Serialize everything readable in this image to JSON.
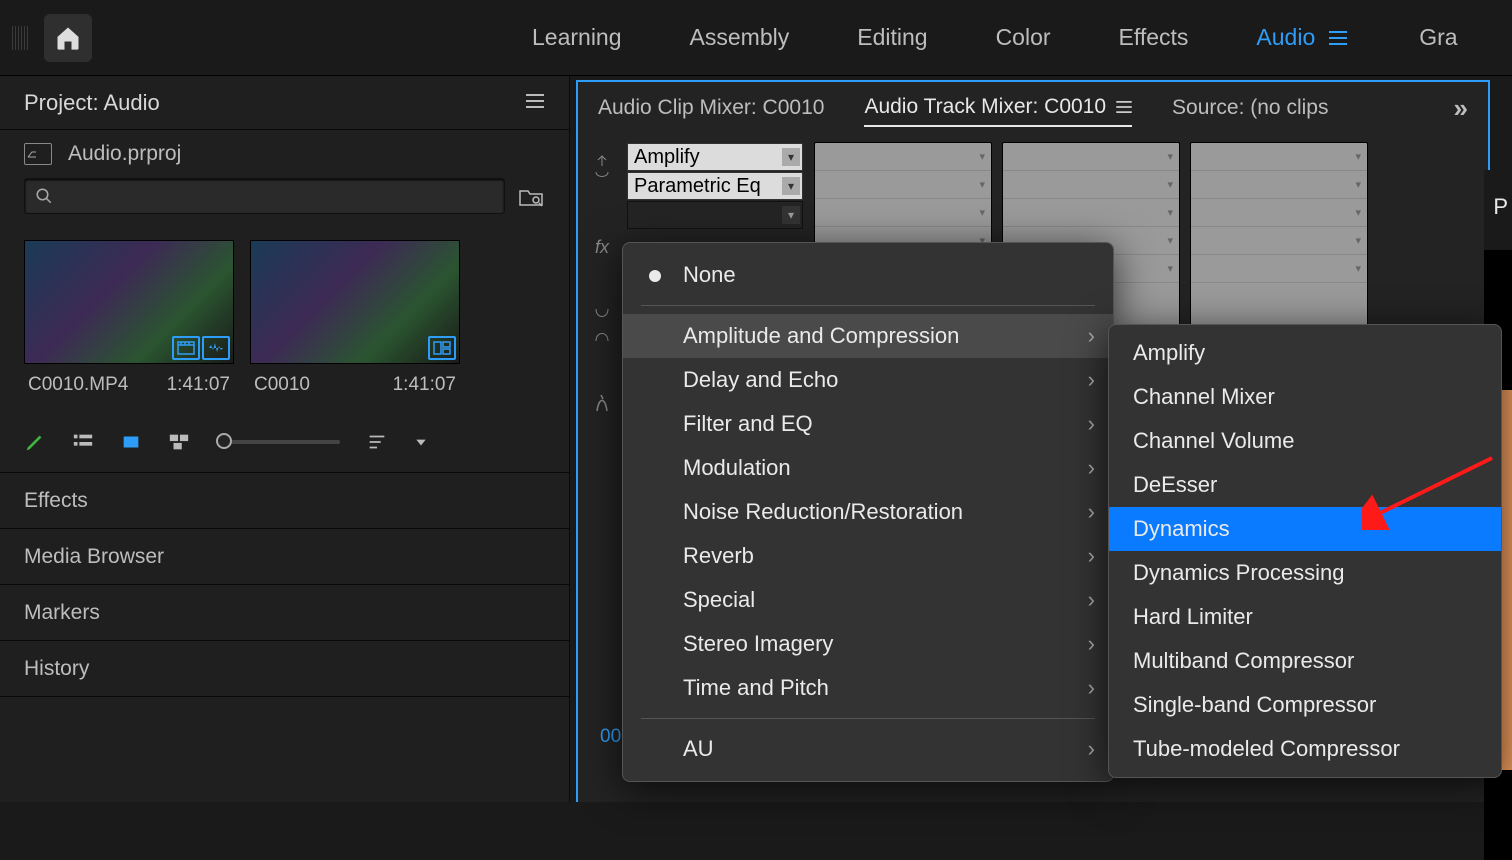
{
  "workspace_tabs": [
    "Learning",
    "Assembly",
    "Editing",
    "Color",
    "Effects",
    "Audio",
    "Gra"
  ],
  "active_workspace": "Audio",
  "project_panel": {
    "title": "Project: Audio",
    "filename": "Audio.prproj",
    "bins": [
      {
        "name": "C0010.MP4",
        "duration": "1:41:07",
        "badges": [
          "video",
          "audio"
        ]
      },
      {
        "name": "C0010",
        "duration": "1:41:07",
        "badges": [
          "sequence"
        ]
      }
    ],
    "sub_panels": [
      "Effects",
      "Media Browser",
      "Markers",
      "History"
    ]
  },
  "mixer": {
    "tabs": [
      "Audio Clip Mixer: C0010",
      "Audio Track Mixer: C0010",
      "Source: (no clips"
    ],
    "active_tab": "Audio Track Mixer: C0010",
    "channel0_slots": [
      "Amplify",
      "Parametric Eq"
    ],
    "rail_labels": {
      "fx": "fx"
    },
    "timecode": "00"
  },
  "context_menu": {
    "none_label": "None",
    "categories": [
      "Amplitude and Compression",
      "Delay and Echo",
      "Filter and EQ",
      "Modulation",
      "Noise Reduction/Restoration",
      "Reverb",
      "Special",
      "Stereo Imagery",
      "Time and Pitch"
    ],
    "au_label": "AU",
    "hover_index": 0
  },
  "submenu": {
    "items": [
      "Amplify",
      "Channel Mixer",
      "Channel Volume",
      "DeEsser",
      "Dynamics",
      "Dynamics Processing",
      "Hard Limiter",
      "Multiband Compressor",
      "Single-band Compressor",
      "Tube-modeled Compressor"
    ],
    "highlight_index": 4
  },
  "preview_panel_letter": "P"
}
